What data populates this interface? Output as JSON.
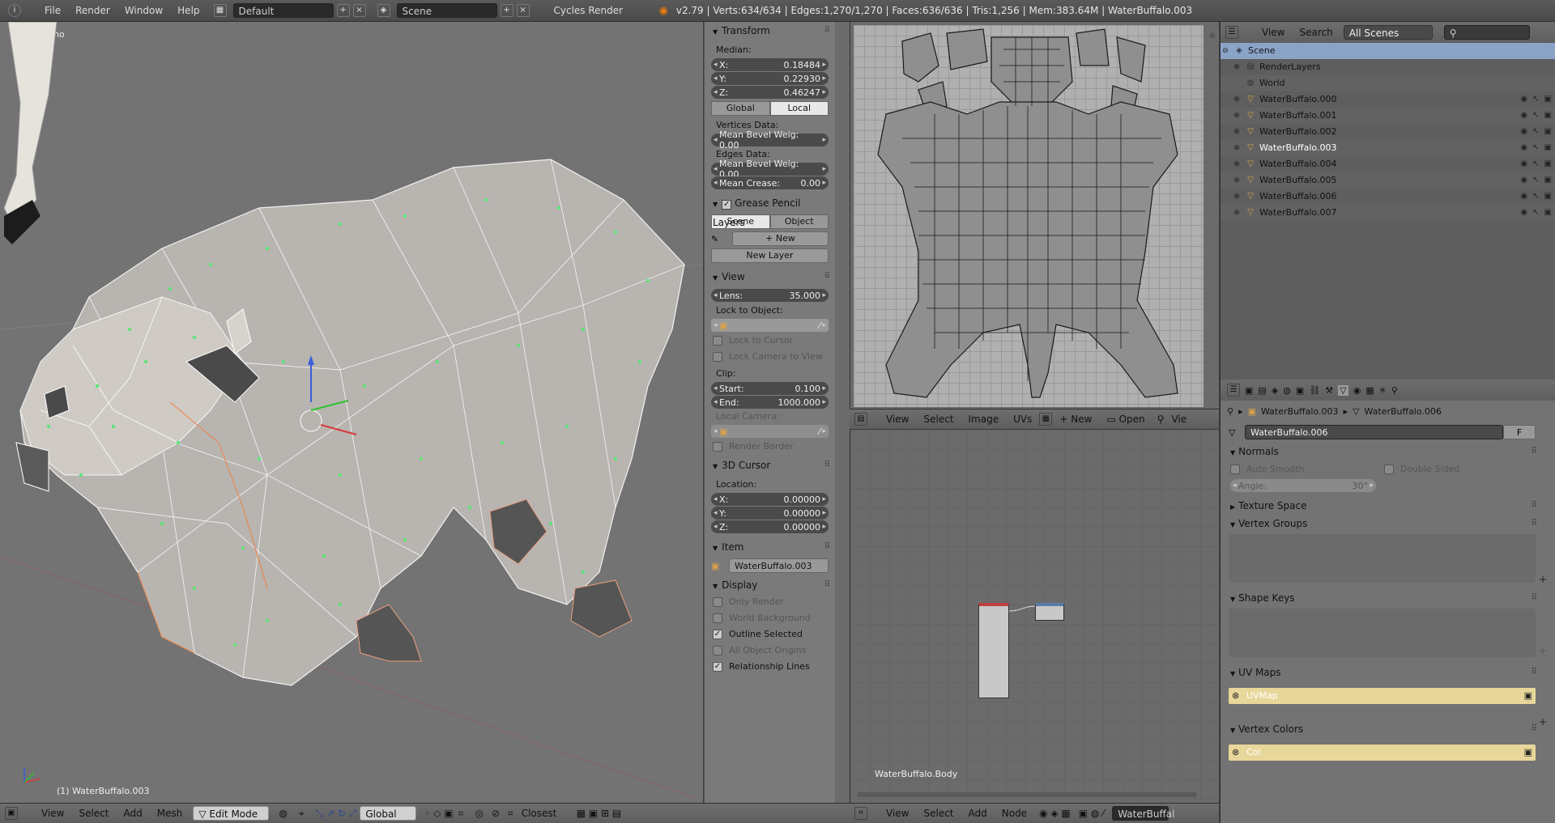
{
  "topbar": {
    "menus": [
      "File",
      "Render",
      "Window",
      "Help"
    ],
    "layout": "Default",
    "scene": "Scene",
    "engine": "Cycles Render",
    "stats": "v2.79 | Verts:634/634 | Edges:1,270/1,270 | Faces:636/636 | Tris:1,256 | Mem:383.64M | WaterBuffalo.003"
  },
  "viewport": {
    "view_name": "User Ortho",
    "object_label": "(1) WaterBuffalo.003",
    "header": {
      "menus": [
        "View",
        "Select",
        "Add",
        "Mesh"
      ],
      "mode": "Edit Mode",
      "orientation": "Global",
      "snap": "Closest"
    }
  },
  "npanel": {
    "transform": {
      "title": "Transform",
      "median_label": "Median:",
      "x_label": "X:",
      "x": "0.18484",
      "y_label": "Y:",
      "y": "0.22930",
      "z_label": "Z:",
      "z": "0.46247",
      "global": "Global",
      "local": "Local",
      "vertices_data": "Vertices Data:",
      "mean_bevel_v": "Mean Bevel Weig: 0.00",
      "edges_data": "Edges Data:",
      "mean_bevel_e": "Mean Bevel Weig: 0.00",
      "mean_crease_label": "Mean Crease:",
      "mean_crease": "0.00"
    },
    "grease": {
      "title": "Grease Pencil Layers",
      "scene": "Scene",
      "object": "Object",
      "new": "New",
      "new_layer": "New Layer"
    },
    "view": {
      "title": "View",
      "lens_label": "Lens:",
      "lens": "35.000",
      "lock_to_object": "Lock to Object:",
      "lock_cursor": "Lock to Cursor",
      "lock_camera": "Lock Camera to View",
      "clip": "Clip:",
      "start_label": "Start:",
      "start": "0.100",
      "end_label": "End:",
      "end": "1000.000",
      "local_camera": "Local Camera:",
      "render_border": "Render Border"
    },
    "cursor": {
      "title": "3D Cursor",
      "location": "Location:",
      "x_label": "X:",
      "x": "0.00000",
      "y_label": "Y:",
      "y": "0.00000",
      "z_label": "Z:",
      "z": "0.00000"
    },
    "item": {
      "title": "Item",
      "name": "WaterBuffalo.003"
    },
    "display": {
      "title": "Display",
      "only_render": "Only Render",
      "world_background": "World Background",
      "outline_selected": "Outline Selected",
      "all_object_origins": "All Object Origins",
      "relationship_lines": "Relationship Lines"
    }
  },
  "uv_editor": {
    "header": {
      "menus": [
        "View",
        "Select",
        "Image",
        "UVs"
      ],
      "new": "New",
      "open": "Open",
      "view": "Vie"
    }
  },
  "node_editor": {
    "material_label": "WaterBuffalo.Body",
    "header": {
      "menus": [
        "View",
        "Select",
        "Add",
        "Node"
      ],
      "field": "WaterBuffal"
    }
  },
  "outliner": {
    "header": {
      "view": "View",
      "search": "Search",
      "scenes": "All Scenes"
    },
    "scene": "Scene",
    "render_layers": "RenderLayers",
    "world": "World",
    "objects": [
      "WaterBuffalo.000",
      "WaterBuffalo.001",
      "WaterBuffalo.002",
      "WaterBuffalo.003",
      "WaterBuffalo.004",
      "WaterBuffalo.005",
      "WaterBuffalo.006",
      "WaterBuffalo.007"
    ]
  },
  "properties": {
    "breadcrumb_obj": "WaterBuffalo.003",
    "breadcrumb_mesh": "WaterBuffalo.006",
    "mesh_name": "WaterBuffalo.006",
    "mesh_f": "F",
    "normals": "Normals",
    "auto_smooth": "Auto Smooth",
    "double_sided": "Double Sided",
    "angle_label": "Angle:",
    "angle": "30°",
    "texture_space": "Texture Space",
    "vertex_groups": "Vertex Groups",
    "shape_keys": "Shape Keys",
    "uv_maps": "UV Maps",
    "uv_map_name": "UVMap",
    "vertex_colors": "Vertex Colors",
    "vc_name": "Col"
  }
}
